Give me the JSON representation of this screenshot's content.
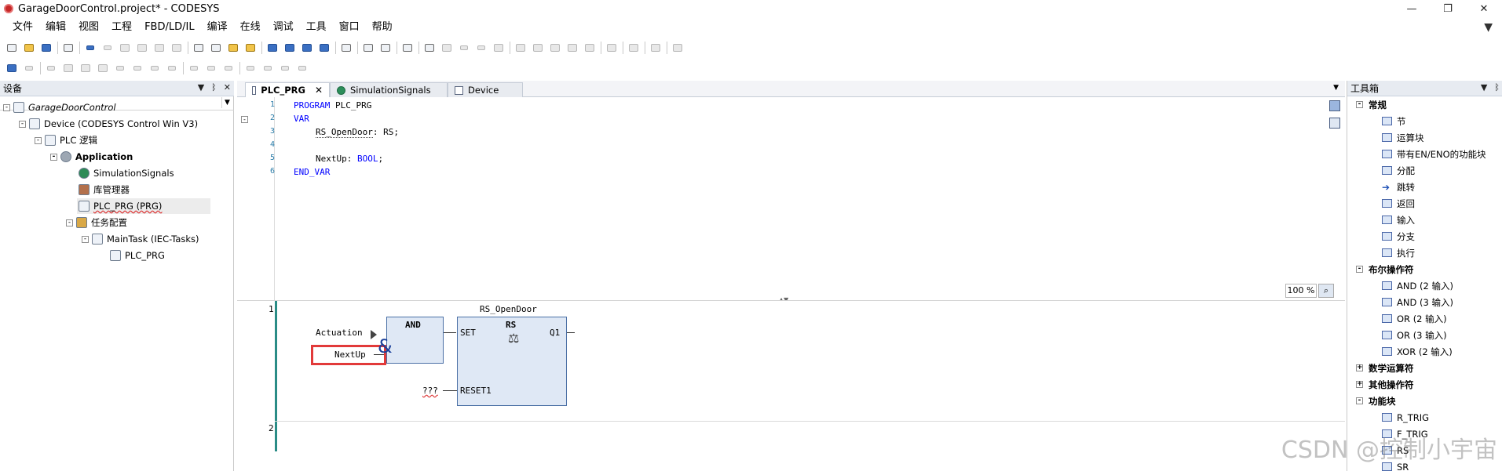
{
  "window": {
    "title": "GarageDoorControl.project* - CODESYS",
    "min_label": "—",
    "max_label": "❐",
    "close_label": "✕"
  },
  "menu": {
    "items": [
      "文件",
      "编辑",
      "视图",
      "工程",
      "FBD/LD/IL",
      "编译",
      "在线",
      "调试",
      "工具",
      "窗口",
      "帮助"
    ],
    "filter_icon": "▼"
  },
  "devices_panel": {
    "title": "设备",
    "header_icons": [
      "▼",
      "ᛒ",
      "✕"
    ],
    "tree": [
      {
        "label": "GarageDoorControl",
        "toggle": "-"
      },
      {
        "label": "Device (CODESYS Control Win V3)",
        "toggle": "-"
      },
      {
        "label": "PLC 逻辑",
        "toggle": "-"
      },
      {
        "label": "Application",
        "toggle": "-"
      },
      {
        "label": "SimulationSignals",
        "toggle": ""
      },
      {
        "label": "库管理器",
        "toggle": ""
      },
      {
        "label": "PLC_PRG (PRG)",
        "toggle": ""
      },
      {
        "label": "任务配置",
        "toggle": "-"
      },
      {
        "label": "MainTask (IEC-Tasks)",
        "toggle": "-"
      },
      {
        "label": "PLC_PRG",
        "toggle": ""
      }
    ]
  },
  "editor": {
    "tabs": [
      {
        "label": "PLC_PRG",
        "close": "✕",
        "active": true
      },
      {
        "label": "SimulationSignals",
        "close": "",
        "active": false
      },
      {
        "label": "Device",
        "close": "",
        "active": false
      }
    ],
    "tabs_dropdown": "▼",
    "lines": [
      "1",
      "2",
      "3",
      "4",
      "5",
      "6"
    ],
    "fold": "-",
    "code": {
      "l1": "PROGRAM",
      "l1b": " PLC_PRG",
      "l2": "VAR",
      "l3a": "RS_OpenDoor",
      "l3b": ": RS;",
      "l5a": "NextUp: ",
      "l5b": "BOOL",
      "l5c": ";",
      "l6": "END_VAR"
    },
    "zoom": "100 %",
    "zoom_icon": "⌕",
    "splitter_marks": "▲▼"
  },
  "fbd": {
    "network_1": "1",
    "network_2": "2",
    "and_block": {
      "title": "AND",
      "symbol": "&"
    },
    "rs_block": {
      "instance": "RS_OpenDoor",
      "title": "RS",
      "pin_set": "SET",
      "pin_reset": "RESET1",
      "pin_out": "Q1",
      "symbol": "⚖"
    },
    "inputs": {
      "actuation": "Actuation",
      "nextup": "NextUp",
      "reset_value": "???"
    }
  },
  "toolbox": {
    "title": "工具箱",
    "header_icons": [
      "▼",
      "ᛒ"
    ],
    "rows": [
      {
        "label": "常规",
        "kind": "category",
        "toggle": "-"
      },
      {
        "label": "节",
        "kind": "item"
      },
      {
        "label": "运算块",
        "kind": "item"
      },
      {
        "label": "带有EN/ENO的功能块",
        "kind": "item"
      },
      {
        "label": "分配",
        "kind": "item"
      },
      {
        "label": "跳转",
        "kind": "item"
      },
      {
        "label": "返回",
        "kind": "item"
      },
      {
        "label": "输入",
        "kind": "item"
      },
      {
        "label": "分支",
        "kind": "item"
      },
      {
        "label": "执行",
        "kind": "item"
      },
      {
        "label": "布尔操作符",
        "kind": "category",
        "toggle": "-"
      },
      {
        "label": "AND (2 输入)",
        "kind": "item"
      },
      {
        "label": "AND (3 输入)",
        "kind": "item"
      },
      {
        "label": "OR (2 输入)",
        "kind": "item"
      },
      {
        "label": "OR (3 输入)",
        "kind": "item"
      },
      {
        "label": "XOR (2 输入)",
        "kind": "item"
      },
      {
        "label": "数学运算符",
        "kind": "category",
        "toggle": "+"
      },
      {
        "label": "其他操作符",
        "kind": "category",
        "toggle": "+"
      },
      {
        "label": "功能块",
        "kind": "category",
        "toggle": "-"
      },
      {
        "label": "R_TRIG",
        "kind": "item"
      },
      {
        "label": "F_TRIG",
        "kind": "item"
      },
      {
        "label": "RS",
        "kind": "item"
      },
      {
        "label": "SR",
        "kind": "item"
      }
    ]
  },
  "watermark": "CSDN @控制小宇宙"
}
